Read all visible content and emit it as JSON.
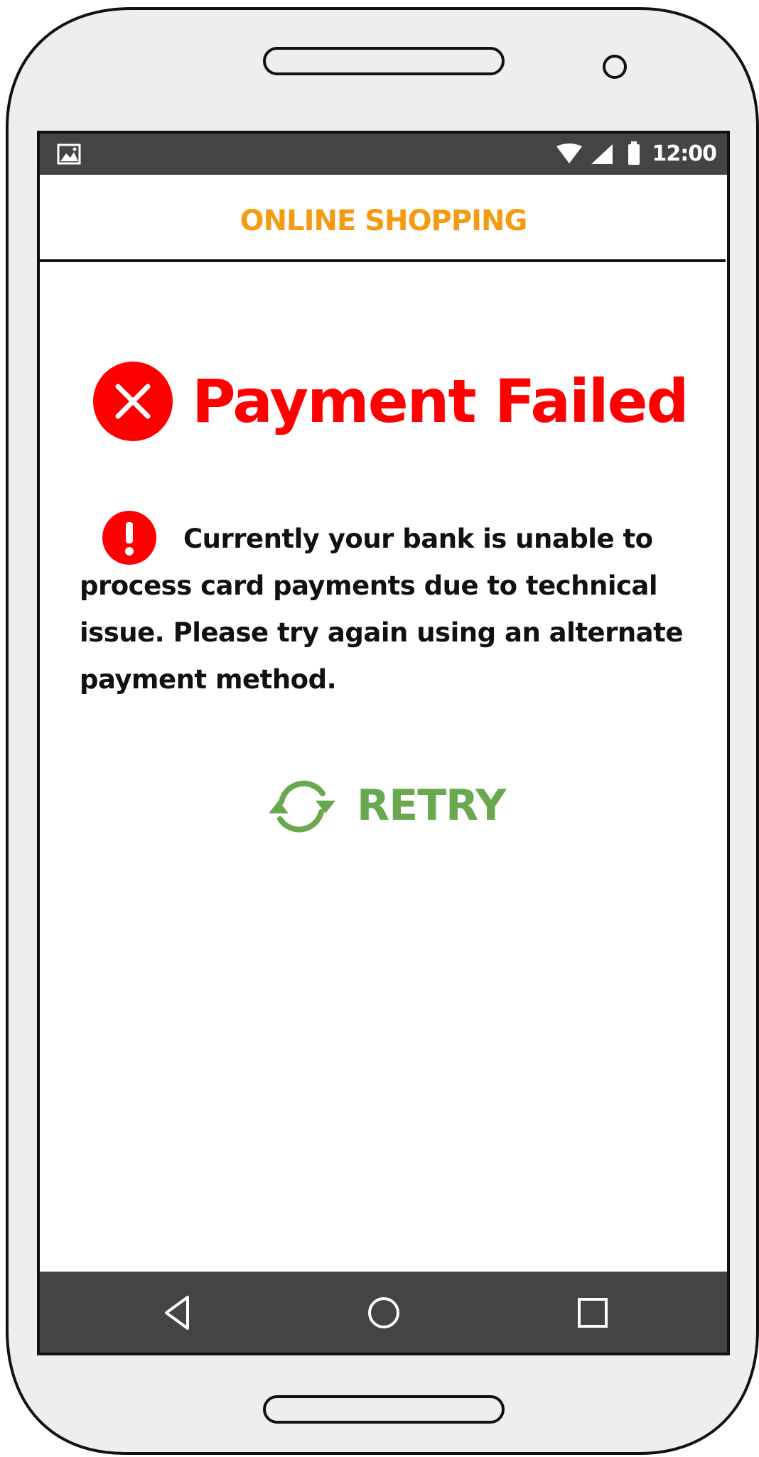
{
  "status_bar": {
    "time": "12:00",
    "icons": [
      "image-icon",
      "wifi-icon",
      "signal-icon",
      "battery-icon"
    ]
  },
  "header": {
    "title": "ONLINE SHOPPING",
    "title_color": "#f39c12"
  },
  "payment": {
    "title": "Payment Failed",
    "title_color": "#ff0000",
    "status_icon": "close-circle-icon",
    "message_icon": "alert-circle-icon",
    "message": "Currently your bank is unable to process card payments due to technical issue. Please try again using an alternate payment method."
  },
  "retry": {
    "label": "RETRY",
    "icon": "refresh-icon",
    "color": "#6aa84f"
  },
  "nav_bar": {
    "buttons": [
      "back-icon",
      "home-icon",
      "recent-apps-icon"
    ]
  }
}
